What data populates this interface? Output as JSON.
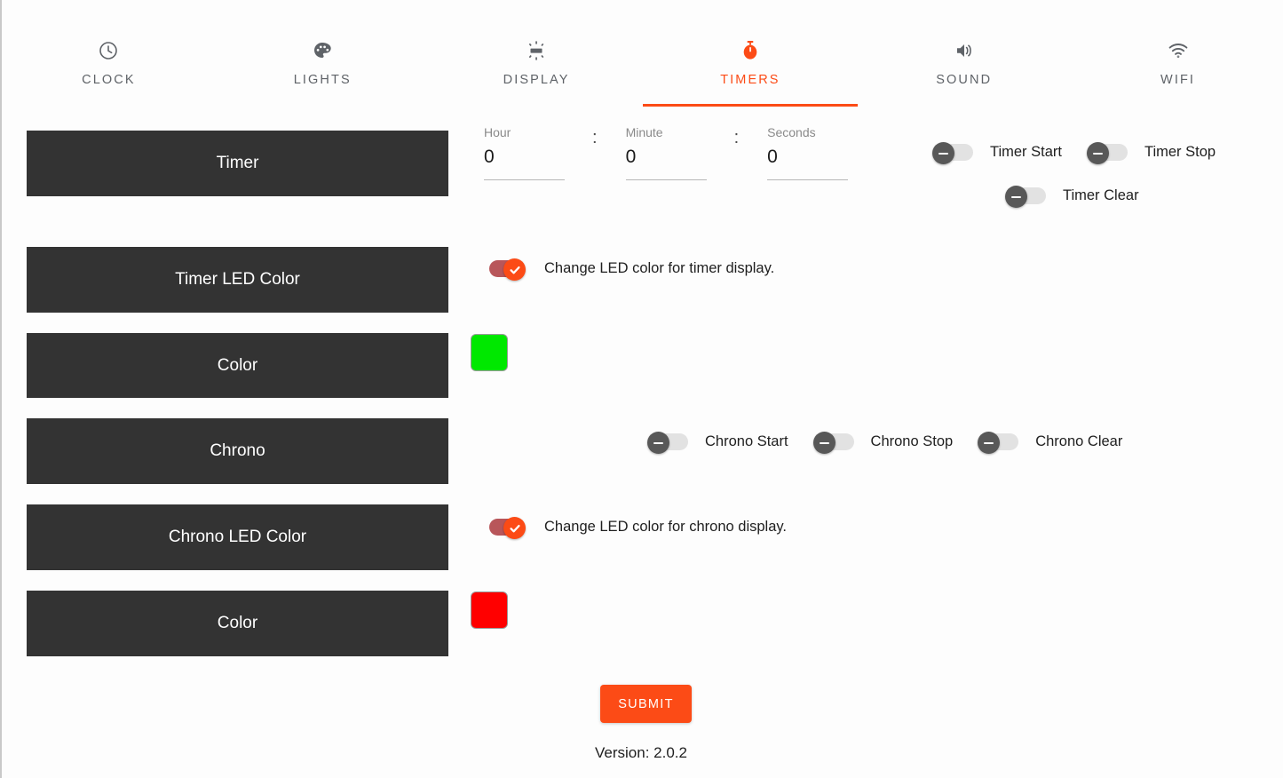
{
  "tabs": [
    {
      "label": "CLOCK",
      "icon": "clock-icon",
      "active": false
    },
    {
      "label": "LIGHTS",
      "icon": "palette-icon",
      "active": false
    },
    {
      "label": "DISPLAY",
      "icon": "brightness-icon",
      "active": false
    },
    {
      "label": "TIMERS",
      "icon": "stopwatch-icon",
      "active": true
    },
    {
      "label": "SOUND",
      "icon": "speaker-icon",
      "active": false
    },
    {
      "label": "WIFI",
      "icon": "wifi-icon",
      "active": false
    }
  ],
  "panels": {
    "timer": "Timer",
    "timer_led_color": "Timer LED Color",
    "color_timer": "Color",
    "chrono": "Chrono",
    "chrono_led_color": "Chrono LED Color",
    "color_chrono": "Color"
  },
  "time_inputs": {
    "hour": {
      "label": "Hour",
      "value": "0"
    },
    "minute": {
      "label": "Minute",
      "value": "0"
    },
    "seconds": {
      "label": "Seconds",
      "value": "0"
    },
    "separator": ":"
  },
  "timer_switches": {
    "start": {
      "label": "Timer Start",
      "state": "off"
    },
    "stop": {
      "label": "Timer Stop",
      "state": "off"
    },
    "clear": {
      "label": "Timer Clear",
      "state": "off"
    }
  },
  "chrono_switches": {
    "start": {
      "label": "Chrono Start",
      "state": "off"
    },
    "stop": {
      "label": "Chrono Stop",
      "state": "off"
    },
    "clear": {
      "label": "Chrono Clear",
      "state": "off"
    }
  },
  "led_toggles": {
    "timer": {
      "label": "Change LED color for timer display.",
      "state": "on"
    },
    "chrono": {
      "label": "Change LED color for chrono display.",
      "state": "on"
    }
  },
  "color_swatches": {
    "timer_led": "#00e800",
    "chrono_led": "#ff0000"
  },
  "submit": {
    "label": "SUBMIT",
    "color": "#fc4b16"
  },
  "version": "Version: 2.0.2",
  "theme": {
    "accent": "#fc4b16",
    "panel_bg": "#333333",
    "tab_inactive": "#5f6368",
    "switch_off_knob": "#585858",
    "switch_off_track": "#e2e2e2",
    "switch_on_track": "#b8565a"
  }
}
